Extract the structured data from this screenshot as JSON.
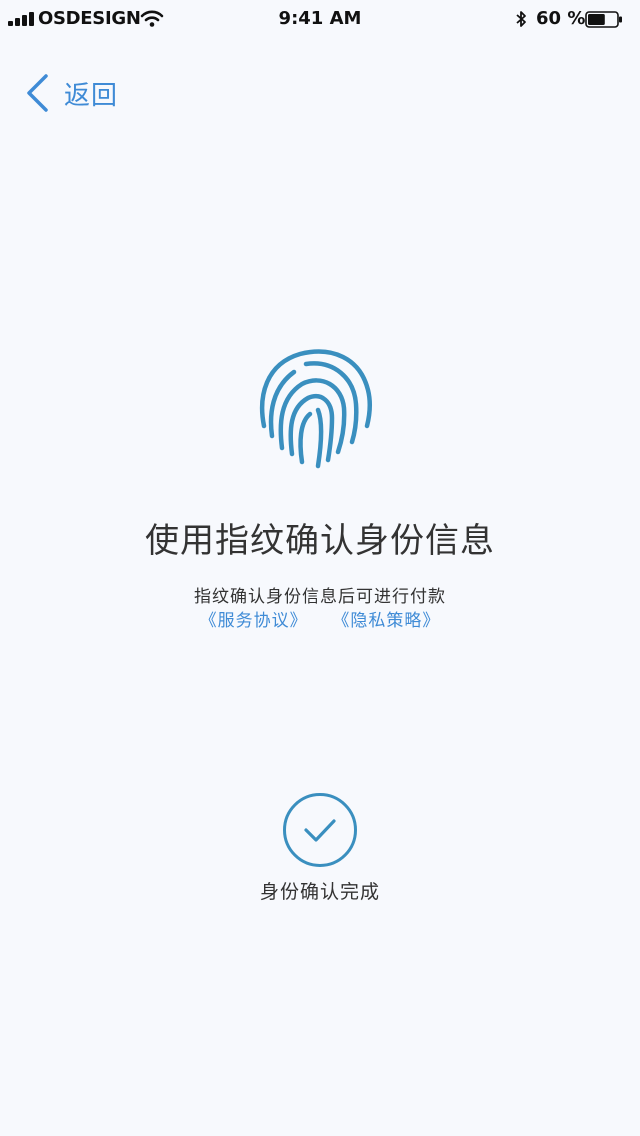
{
  "status_bar": {
    "carrier": "OSDESIGN",
    "time": "9:41 AM",
    "battery_percent": "60 %",
    "battery_level": 0.6,
    "icons": [
      "signal-icon",
      "wifi-icon",
      "bluetooth-icon",
      "battery-icon"
    ]
  },
  "nav": {
    "back_label": "返回",
    "back_icon": "chevron-left-icon"
  },
  "main": {
    "icon": "fingerprint-icon",
    "title": "使用指纹确认身份信息",
    "subtitle": "指纹确认身份信息后可进行付款",
    "links": {
      "service_agreement": "《服务协议》",
      "privacy_policy": "《隐私策略》"
    }
  },
  "completion": {
    "icon": "check-circle-icon",
    "label": "身份确认完成"
  },
  "colors": {
    "accent_blue": "#3f8bd6",
    "fingerprint_blue": "#3a8fbf",
    "background": "#f7f9fd",
    "text": "#333333"
  }
}
